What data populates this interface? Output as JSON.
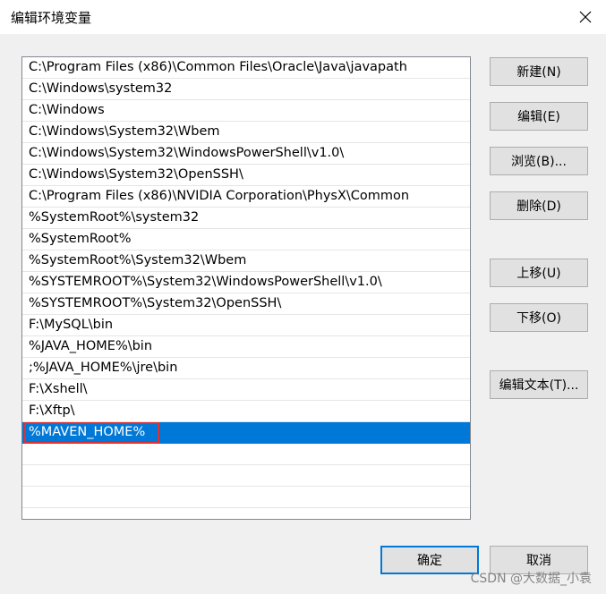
{
  "window": {
    "title": "编辑环境变量",
    "close_icon": "close-icon"
  },
  "path_list": {
    "items": [
      "C:\\Program Files (x86)\\Common Files\\Oracle\\Java\\javapath",
      "C:\\Windows\\system32",
      "C:\\Windows",
      "C:\\Windows\\System32\\Wbem",
      "C:\\Windows\\System32\\WindowsPowerShell\\v1.0\\",
      "C:\\Windows\\System32\\OpenSSH\\",
      "C:\\Program Files (x86)\\NVIDIA Corporation\\PhysX\\Common",
      "%SystemRoot%\\system32",
      "%SystemRoot%",
      "%SystemRoot%\\System32\\Wbem",
      "%SYSTEMROOT%\\System32\\WindowsPowerShell\\v1.0\\",
      "%SYSTEMROOT%\\System32\\OpenSSH\\",
      "F:\\MySQL\\bin",
      "%JAVA_HOME%\\bin",
      ";%JAVA_HOME%\\jre\\bin",
      "F:\\Xshell\\",
      "F:\\Xftp\\",
      "%MAVEN_HOME%"
    ],
    "selected_index": 17,
    "selection_color": "#0078d7",
    "highlight_color": "#e03131"
  },
  "buttons": {
    "new": "新建(N)",
    "edit": "编辑(E)",
    "browse": "浏览(B)...",
    "delete": "删除(D)",
    "move_up": "上移(U)",
    "move_down": "下移(O)",
    "edit_text": "编辑文本(T)...",
    "ok": "确定",
    "cancel": "取消"
  },
  "watermark": "CSDN @大数据_小袁"
}
